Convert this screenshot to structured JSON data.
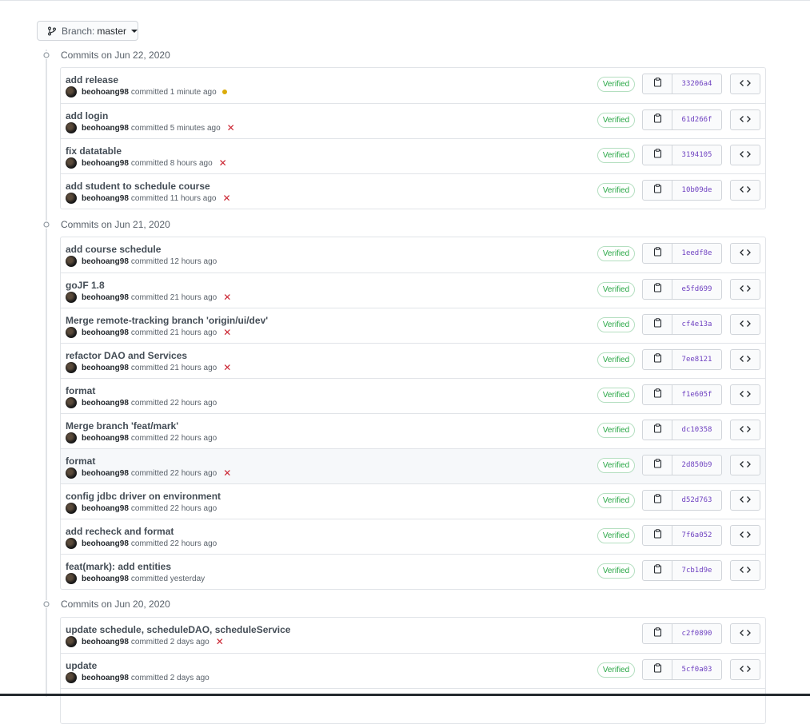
{
  "branch": {
    "label": "Branch:",
    "value": "master"
  },
  "groups": [
    {
      "title": "Commits on Jun 22, 2020",
      "commits": [
        {
          "message": "add release",
          "author": "beohoang98",
          "time": "committed 1 minute ago",
          "status": "pending",
          "verified": "Verified",
          "sha": "33206a4"
        },
        {
          "message": "add login",
          "author": "beohoang98",
          "time": "committed 5 minutes ago",
          "status": "failure",
          "verified": "Verified",
          "sha": "61d266f"
        },
        {
          "message": "fix datatable",
          "author": "beohoang98",
          "time": "committed 8 hours ago",
          "status": "failure",
          "verified": "Verified",
          "sha": "3194105"
        },
        {
          "message": "add student to schedule course",
          "author": "beohoang98",
          "time": "committed 11 hours ago",
          "status": "failure",
          "verified": "Verified",
          "sha": "10b09de"
        }
      ]
    },
    {
      "title": "Commits on Jun 21, 2020",
      "commits": [
        {
          "message": "add course schedule",
          "author": "beohoang98",
          "time": "committed 12 hours ago",
          "status": "none",
          "verified": "Verified",
          "sha": "1eedf8e"
        },
        {
          "message": "goJF 1.8",
          "author": "beohoang98",
          "time": "committed 21 hours ago",
          "status": "failure",
          "verified": "Verified",
          "sha": "e5fd699"
        },
        {
          "message": "Merge remote-tracking branch 'origin/ui/dev'",
          "author": "beohoang98",
          "time": "committed 21 hours ago",
          "status": "failure",
          "verified": "Verified",
          "sha": "cf4e13a"
        },
        {
          "message": "refactor DAO and Services",
          "author": "beohoang98",
          "time": "committed 21 hours ago",
          "status": "failure",
          "verified": "Verified",
          "sha": "7ee8121"
        },
        {
          "message": "format",
          "author": "beohoang98",
          "time": "committed 22 hours ago",
          "status": "none",
          "verified": "Verified",
          "sha": "f1e605f"
        },
        {
          "message": "Merge branch 'feat/mark'",
          "author": "beohoang98",
          "time": "committed 22 hours ago",
          "status": "none",
          "verified": "Verified",
          "sha": "dc10358"
        },
        {
          "message": "format",
          "author": "beohoang98",
          "time": "committed 22 hours ago",
          "status": "failure",
          "verified": "Verified",
          "sha": "2d850b9",
          "highlight": true
        },
        {
          "message": "config jdbc driver on environment",
          "author": "beohoang98",
          "time": "committed 22 hours ago",
          "status": "none",
          "verified": "Verified",
          "sha": "d52d763"
        },
        {
          "message": "add recheck and format",
          "author": "beohoang98",
          "time": "committed 22 hours ago",
          "status": "none",
          "verified": "Verified",
          "sha": "7f6a052"
        },
        {
          "message": "feat(mark): add entities",
          "author": "beohoang98",
          "time": "committed yesterday",
          "status": "none",
          "verified": "Verified",
          "sha": "7cb1d9e"
        }
      ]
    },
    {
      "title": "Commits on Jun 20, 2020",
      "commits": [
        {
          "message": "update schedule, scheduleDAO, scheduleService",
          "author": "beohoang98",
          "time": "committed 2 days ago",
          "status": "failure",
          "verified": "",
          "sha": "c2f0890"
        },
        {
          "message": "update",
          "author": "beohoang98",
          "time": "committed 2 days ago",
          "status": "none",
          "verified": "Verified",
          "sha": "5cf0a03"
        },
        {
          "message": "",
          "author": "",
          "time": "",
          "status": "none",
          "verified": "",
          "sha": ""
        }
      ]
    }
  ],
  "icons": {
    "branch": "git-branch-icon",
    "commit": "commit-dot-icon",
    "copy": "clipboard-icon",
    "browse": "code-icon"
  },
  "colors": {
    "verified": "#28a745",
    "sha": "#6f42c1",
    "failure": "#cb2431",
    "pending": "#dbab09"
  }
}
